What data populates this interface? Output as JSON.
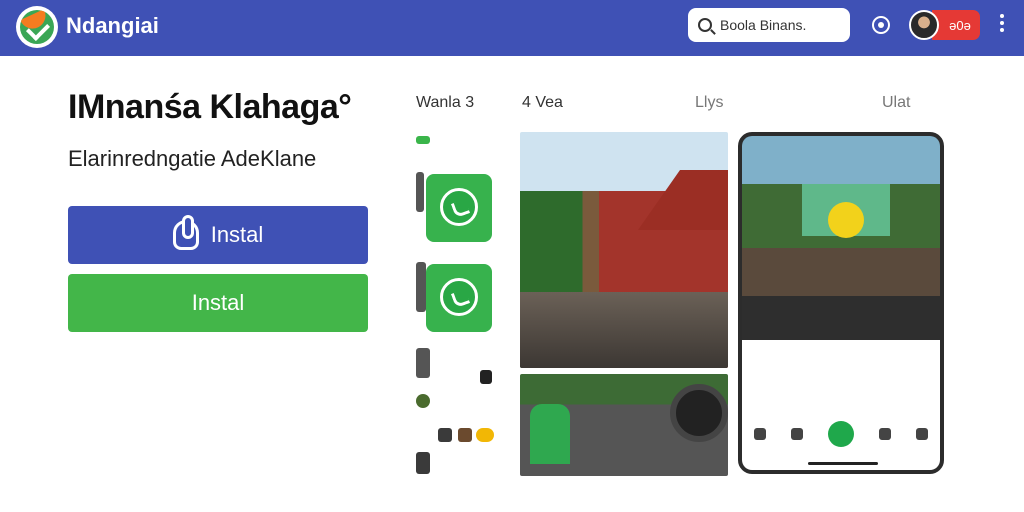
{
  "header": {
    "app_name": "Ndangiai",
    "search_value": "Boola Binans.",
    "badge_text": "ə0ə"
  },
  "hero": {
    "title": "IMnanśa Klahaga°",
    "subtitle": "Elarinredngatie AdeKlane",
    "primary_button": "Instal",
    "secondary_button": "Instal"
  },
  "gallery": {
    "strip_label": "Wanla 3",
    "photos_label": "4 Vea",
    "phone_label": "Llys",
    "info_label": "Ulat"
  },
  "icons": [
    "logo-icon",
    "search-icon",
    "info-icon",
    "avatar",
    "more-vert-icon",
    "hand-icon",
    "whatsapp-icon",
    "home-icon",
    "chat-icon",
    "app-icon",
    "menu-icon"
  ],
  "colors": {
    "header": "#3f51b5",
    "primary": "#3f51b5",
    "secondary": "#43b649",
    "badge": "#e53935"
  }
}
